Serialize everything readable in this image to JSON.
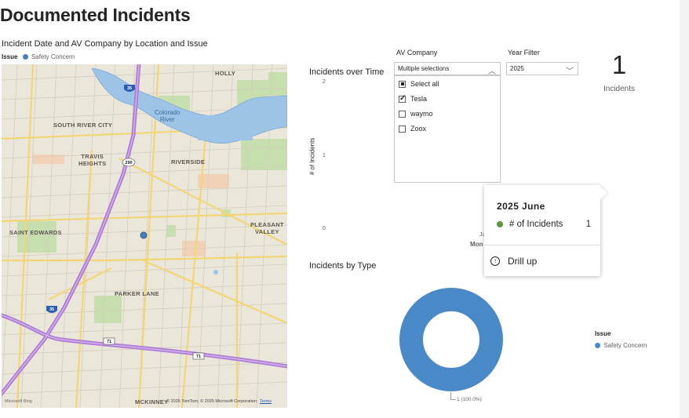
{
  "page": {
    "title": "Documented Incidents"
  },
  "map_visual": {
    "title": "Incident Date and AV Company by Location and Issue",
    "legend_title": "Issue",
    "legend_items": [
      {
        "label": "Safety Concern",
        "color": "#4a7ebb"
      }
    ],
    "labels": {
      "holly": "HOLLY",
      "south_river_city": "SOUTH RIVER CITY",
      "travis_heights": "TRAVIS\nHEIGHTS",
      "riverside": "RIVERSIDE",
      "saint_edwards": "SAINT EDWARDS",
      "pleasant_valley": "PLEASANT\nVALLEY",
      "parker_lane": "PARKER LANE",
      "mckinney": "MCKINNEY",
      "colorado_river": "Colorado\nRiver"
    },
    "route_shields": [
      "35",
      "290",
      "35",
      "71",
      "71"
    ],
    "attribution": "© 2025 TomTom, © 2025 Microsoft Corporation",
    "terms_link": "Terms",
    "brand": "Microsoft Bing"
  },
  "incidents_over_time": {
    "title": "Incidents over Time",
    "y_axis_label": "# of Incidents",
    "y_ticks": [
      "2",
      "1",
      "0"
    ],
    "x_tick_partial": "Ju",
    "x_axis_partial": "Mon"
  },
  "av_company_slicer": {
    "label": "AV Company",
    "selected_text": "Multiple selections",
    "options": [
      {
        "label": "Select all",
        "state": "partial"
      },
      {
        "label": "Tesla",
        "state": "checked"
      },
      {
        "label": "waymo",
        "state": "unchecked"
      },
      {
        "label": "Zoox",
        "state": "unchecked"
      }
    ]
  },
  "year_slicer": {
    "label": "Year Filter",
    "selected_text": "2025"
  },
  "kpi_card": {
    "value": "1",
    "label": "Incidents"
  },
  "tooltip": {
    "title": "2025 June",
    "measure_label": "# of Incidents",
    "measure_value": "1",
    "measure_color": "#5b9a3c",
    "action_label": "Drill up"
  },
  "incidents_by_type": {
    "title": "Incidents by Type",
    "legend_title": "Issue",
    "legend_items": [
      {
        "label": "Safety Concern",
        "color": "#4a89c8"
      }
    ]
  },
  "chart_data": {
    "type": "pie",
    "title": "Incidents by Type",
    "categories": [
      "Safety Concern"
    ],
    "values": [
      1
    ],
    "data_labels": [
      "1 (100.0%)"
    ],
    "donut": true,
    "legend_title": "Issue",
    "legend_position": "right",
    "colors": [
      "#4a89c8"
    ]
  }
}
